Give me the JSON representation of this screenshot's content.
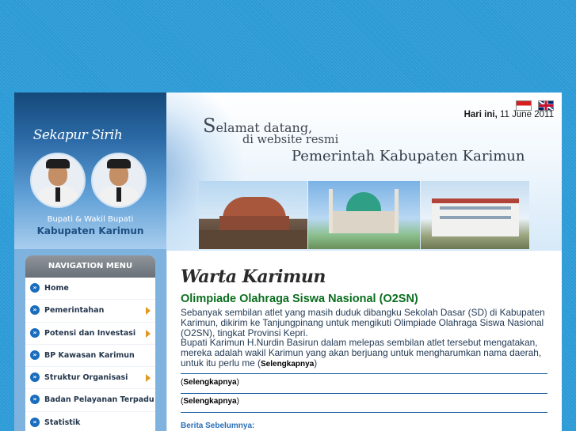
{
  "sambutan": {
    "title": "Sekapur Sirih",
    "caption1": "Bupati & Wakil Bupati",
    "caption2": "Kabupaten Karimun"
  },
  "nav": {
    "header": "NAVIGATION MENU",
    "items": [
      {
        "label": "Home",
        "submenu": false
      },
      {
        "label": "Pemerintahan",
        "submenu": true
      },
      {
        "label": "Potensi dan Investasi",
        "submenu": true
      },
      {
        "label": "BP Kawasan Karimun",
        "submenu": false
      },
      {
        "label": "Struktur Organisasi",
        "submenu": true
      },
      {
        "label": "Badan Pelayanan Terpadu",
        "submenu": false
      },
      {
        "label": "Statistik",
        "submenu": false
      }
    ]
  },
  "header": {
    "flags": [
      "flag-indonesia-icon",
      "flag-uk-icon"
    ],
    "date_label": "Hari ini,",
    "date_value": "11 June 2011",
    "welcome_s": "S",
    "welcome_line1": "elamat datang,",
    "welcome_line2": "di website resmi",
    "welcome_line3": "Pemerintah Kabupaten Karimun"
  },
  "main": {
    "section_title": "Warta Karimun",
    "article_title": "Olimpiade Olahraga Siswa Nasional (O2SN)",
    "article_p1": "Sebanyak sembilan atlet yang masih duduk dibangku Sekolah Dasar (SD) di Kabupaten Karimun, dikirim ke Tanjungpinang untuk mengikuti Olimpiade Olahraga Siswa Nasional (O2SN), tingkat Provinsi Kepri.",
    "article_p2": "Bupati Karimun H.Nurdin Basirun dalam melepas sembilan atlet tersebut mengatakan, mereka adalah wakil Karimun yang akan berjuang untuk mengharumkan nama daerah, untuk itu perlu me",
    "more_label": "Selengkapnya",
    "previous_label": "Berita Sebelumnya:"
  },
  "colors": {
    "page_bg": "#2a9ad6",
    "nav_header": "#7a8086",
    "article_title": "#0a6e1e",
    "link_blue": "#2a6fb6"
  }
}
